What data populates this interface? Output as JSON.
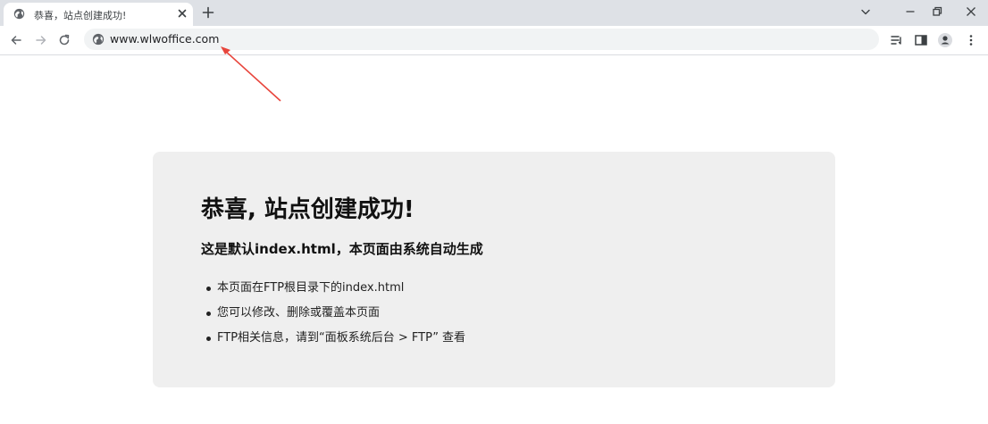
{
  "browser": {
    "tab": {
      "title": "恭喜，站点创建成功!",
      "favicon": "globe-icon"
    },
    "new_tab_label": "+",
    "address_bar": {
      "url": "www.wlwoffice.com",
      "site_icon": "globe-icon"
    },
    "window_controls": [
      "tab-search-icon",
      "minimize-icon",
      "restore-icon",
      "close-icon"
    ],
    "toolbar_right": [
      "reading-list-icon",
      "side-panel-icon",
      "profile-icon",
      "menu-icon"
    ],
    "annotation_color": "#e8453c"
  },
  "page": {
    "title": "恭喜, 站点创建成功!",
    "subtitle": "这是默认index.html，本页面由系统自动生成",
    "items": [
      "本页面在FTP根目录下的index.html",
      "您可以修改、删除或覆盖本页面",
      "FTP相关信息，请到“面板系统后台 > FTP” 查看"
    ],
    "card_color": "#efefef"
  }
}
